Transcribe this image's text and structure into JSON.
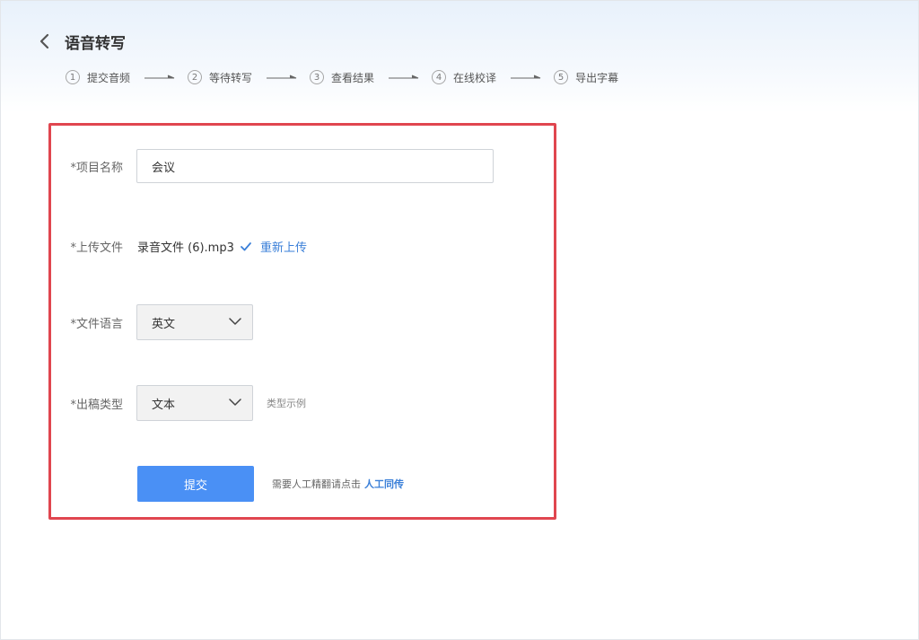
{
  "header": {
    "title": "语音转写",
    "back_icon": "chevron-left-icon"
  },
  "steps": [
    {
      "num": "1",
      "label": "提交音频"
    },
    {
      "num": "2",
      "label": "等待转写"
    },
    {
      "num": "3",
      "label": "查看结果"
    },
    {
      "num": "4",
      "label": "在线校译"
    },
    {
      "num": "5",
      "label": "导出字幕"
    }
  ],
  "form": {
    "project_name": {
      "label": "*项目名称",
      "value": "会议"
    },
    "upload": {
      "label": "*上传文件",
      "file_name": "录音文件 (6).mp3",
      "reupload": "重新上传",
      "status_icon": "check-icon"
    },
    "language": {
      "label": "*文件语言",
      "selected": "英文"
    },
    "output_type": {
      "label": "*出稿类型",
      "selected": "文本",
      "hint": "类型示例"
    },
    "submit_label": "提交",
    "note": "需要人工精翻请点击",
    "note_link": "人工同传"
  },
  "colors": {
    "accent": "#4a90f5",
    "link": "#3a7fd8",
    "highlight_border": "#e0464f"
  }
}
